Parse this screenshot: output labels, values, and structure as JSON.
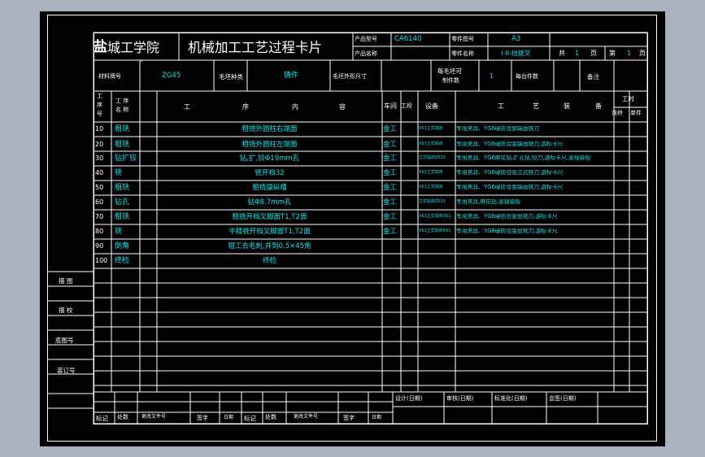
{
  "header": {
    "school_prefix": "盐",
    "school_rest": "城工学院",
    "card_title": "机械加工工艺过程卡片",
    "product_model_label": "产品型号",
    "product_model_value": "CA6140",
    "part_drawing_no_label": "零件图号",
    "part_drawing_no_value": "A3",
    "product_name_label": "产品名称",
    "part_name_label": "零件名称",
    "part_name_value": "I-II-挡拨叉",
    "total_label": "共",
    "total_value": "1",
    "page_unit_1": "页",
    "current_label": "第",
    "current_value": "1",
    "page_unit_2": "页"
  },
  "material_row": {
    "material_label": "材料牌号",
    "material_value": "ZG45",
    "blank_type_label": "毛坯种类",
    "blank_type_value": "铸件",
    "blank_size_label": "毛坯外形尺寸",
    "per_blank_label_1": "每毛坯可",
    "per_blank_label_2": "制件数",
    "per_blank_value": "1",
    "per_unit_label": "每台件数",
    "remark_label": "备注"
  },
  "columns": {
    "op_no_1": "工",
    "op_no_2": "序",
    "op_no_3": "号",
    "op_name_1": "工 序",
    "op_name_2": "名 称",
    "content_1": "工",
    "content_2": "序",
    "content_3": "内",
    "content_4": "容",
    "workshop": "车间",
    "section": "工段",
    "equipment": "设备",
    "tooling_1": "工",
    "tooling_2": "艺",
    "tooling_3": "装",
    "tooling_4": "备",
    "hours": "工时",
    "prep": "准终",
    "unit": "单件"
  },
  "operations": [
    {
      "no": "10",
      "name": "粗铣",
      "content": "粗铣外圆柱右端面",
      "workshop": "金工",
      "equipment": "X51立式铣床",
      "tooling": "专用夹具、YG6硬质合金端面铣刀"
    },
    {
      "no": "20",
      "name": "粗铣",
      "content": "粗铣外圆柱左端面",
      "workshop": "金工",
      "equipment": "X51立式铣床",
      "tooling": "专用夹具、YG6硬质合金端面铣刀,游标卡尺"
    },
    {
      "no": "30",
      "name": "钻扩铰",
      "content": "钻,扩,铰Φ19mm孔",
      "workshop": "金工",
      "equipment": "立式钻床Z525",
      "tooling": "专用夹具、YG6麻花钻,扩孔钻,铰刀,游标卡尺,塞规量规"
    },
    {
      "no": "40",
      "name": "铣",
      "content": "铣开档32",
      "workshop": "金工",
      "equipment": "X51立式铣床",
      "tooling": "专用夹具、YG6硬质合金立式铣刀,游标卡尺"
    },
    {
      "no": "50",
      "name": "粗铣",
      "content": "粗铣操纵槽",
      "workshop": "金工",
      "equipment": "X51立式铣床",
      "tooling": "专用夹具、YG6硬质合金端面铣刀,游标卡尺"
    },
    {
      "no": "60",
      "name": "钻孔",
      "content": "钻Φ8.7mm孔",
      "workshop": "金工",
      "equipment": "立式钻床Z525",
      "tooling": "专用夹具,麻花钻,塞规量规"
    },
    {
      "no": "70",
      "name": "粗铣",
      "content": "粗铣开档叉脚面T1,T2面",
      "workshop": "金工",
      "equipment": "X61立式铣床X61",
      "tooling": "专用夹具、YG8硬质合金盘铣刀,游标卡尺"
    },
    {
      "no": "80",
      "name": "铣",
      "content": "半精铣开档叉脚面T1,T2面",
      "workshop": "金工",
      "equipment": "X61立式铣床X61",
      "tooling": "专用夹具、YG8硬质合金盘铣刀,游标卡尺"
    },
    {
      "no": "90",
      "name": "倒角",
      "content": "钳工去毛刺,并到0.5×45角",
      "workshop": "",
      "equipment": "",
      "tooling": ""
    },
    {
      "no": "100",
      "name": "终检",
      "content": "终检",
      "workshop": "",
      "equipment": "",
      "tooling": ""
    }
  ],
  "side_labels": {
    "trace": "描 图",
    "check": "描 校",
    "base_drawing_no": "底图号",
    "binding_no": "装订号"
  },
  "signoff": {
    "design": "设计(日期)",
    "review": "审核(日期)",
    "standardize": "标准化(日期)",
    "countersign": "会签(日期)"
  },
  "revision": {
    "mark": "标记",
    "count": "处数",
    "change_doc_no": "更改文件号",
    "sign": "签字",
    "date": "日期",
    "mark_2": "标记",
    "count_2": "处数",
    "change_doc_no_2": "更改文件号",
    "sign_2": "签字",
    "date_2": "日期"
  },
  "colors": {
    "background": "#a9b2be",
    "sheet": "#000000",
    "label": "#ffffff",
    "value": "#00e5e5"
  }
}
